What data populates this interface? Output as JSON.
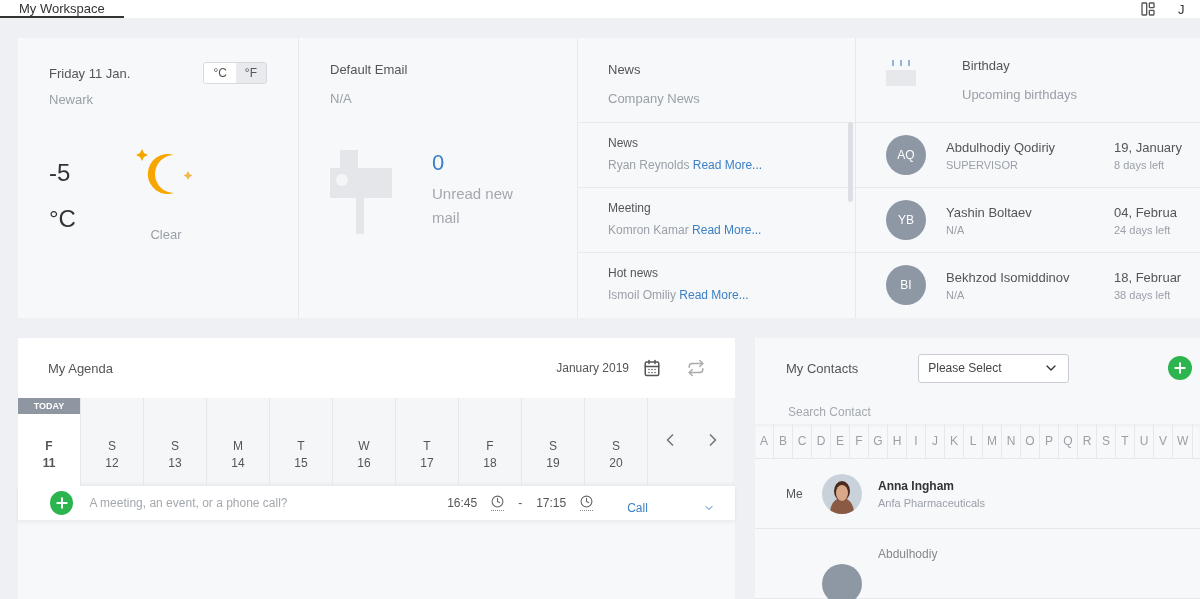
{
  "top_bar": {
    "tabs": [
      {
        "label": "My Workspace",
        "selected": true
      }
    ],
    "user_initial": "J"
  },
  "weather": {
    "date": "Friday 11 Jan.",
    "city": "Newark",
    "units": [
      {
        "label": "°C",
        "selected": false
      },
      {
        "label": "°F",
        "selected": true
      }
    ],
    "temperature": "-5",
    "unit": "°C",
    "condition": "Clear"
  },
  "email": {
    "title": "Default Email",
    "account": "N/A",
    "count": "0",
    "caption": "Unread new mail"
  },
  "news": {
    "title": "News",
    "subtitle": "Company News",
    "items": [
      {
        "title": "News",
        "author": "Ryan Reynolds",
        "link": "Read More..."
      },
      {
        "title": "Meeting",
        "author": "Komron Kamar",
        "link": "Read More..."
      },
      {
        "title": "Hot news",
        "author": "Ismoil Omiliy",
        "link": "Read More..."
      }
    ]
  },
  "birthday": {
    "title": "Birthday",
    "subtitle": "Upcoming birthdays",
    "people": [
      {
        "initials": "AQ",
        "name": "Abdulhodiy Qodiriy",
        "role": "SUPERVISOR",
        "date": "19, January",
        "days_left": "8 days left"
      },
      {
        "initials": "YB",
        "name": "Yashin Boltaev",
        "role": "N/A",
        "date": "04, Februa",
        "days_left": "24 days left"
      },
      {
        "initials": "BI",
        "name": "Bekhzod Isomiddinov",
        "role": "N/A",
        "date": "18, Februar",
        "days_left": "38 days left"
      }
    ]
  },
  "agenda": {
    "title": "My Agenda",
    "month": "January 2019",
    "today_label": "TODAY",
    "days": [
      {
        "weekday": "F",
        "day": "11",
        "selected": true
      },
      {
        "weekday": "S",
        "day": "12",
        "selected": false
      },
      {
        "weekday": "S",
        "day": "13",
        "selected": false
      },
      {
        "weekday": "M",
        "day": "14",
        "selected": false
      },
      {
        "weekday": "T",
        "day": "15",
        "selected": false
      },
      {
        "weekday": "W",
        "day": "16",
        "selected": false
      },
      {
        "weekday": "T",
        "day": "17",
        "selected": false
      },
      {
        "weekday": "F",
        "day": "18",
        "selected": false
      },
      {
        "weekday": "S",
        "day": "19",
        "selected": false
      },
      {
        "weekday": "S",
        "day": "20",
        "selected": false
      }
    ],
    "entry": {
      "placeholder": "A meeting, an event, or a phone call?",
      "start": "16:45",
      "separator": "-",
      "end": "17:15",
      "type": "Call"
    }
  },
  "contacts": {
    "title": "My Contacts",
    "filter": "Please Select",
    "search_placeholder": "Search Contact",
    "letters": [
      "A",
      "B",
      "C",
      "D",
      "E",
      "F",
      "G",
      "H",
      "I",
      "J",
      "K",
      "L",
      "M",
      "N",
      "O",
      "P",
      "Q",
      "R",
      "S",
      "T",
      "U",
      "V",
      "W"
    ],
    "people": [
      {
        "label": "Me",
        "name": "Anna Ingham",
        "company": "Anfa Pharmaceuticals"
      },
      {
        "kind": "initials",
        "name": "Abdulhodiy"
      }
    ]
  }
}
